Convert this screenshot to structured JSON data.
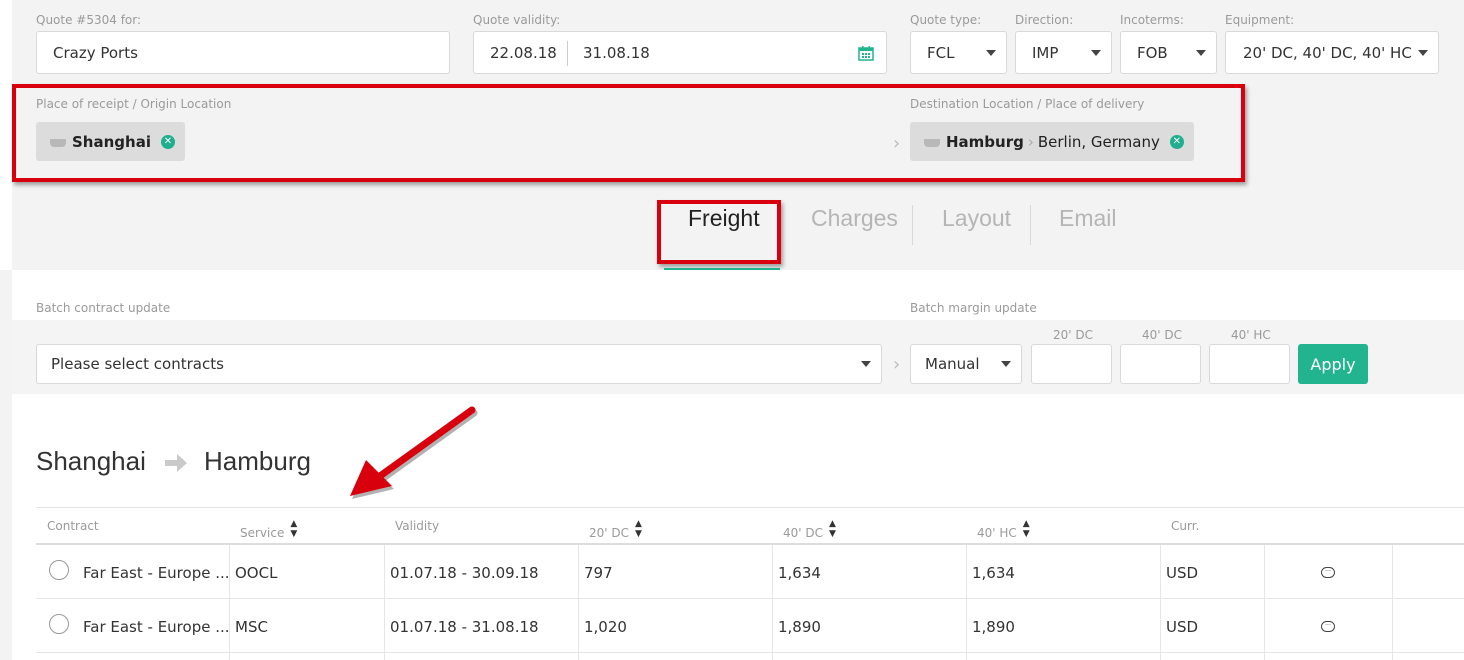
{
  "quote": {
    "title_label": "Quote #5304 for:",
    "customer": "Crazy Ports",
    "validity_label": "Quote validity:",
    "valid_from": "22.08.18",
    "valid_to": "31.08.18",
    "type_label": "Quote type:",
    "type_value": "FCL",
    "direction_label": "Direction:",
    "direction_value": "IMP",
    "incoterms_label": "Incoterms:",
    "incoterms_value": "FOB",
    "equipment_label": "Equipment:",
    "equipment_value": "20' DC, 40' DC, 40' HC"
  },
  "route": {
    "origin_label": "Place of receipt / Origin Location",
    "origin": "Shanghai",
    "destination_label": "Destination Location / Place of delivery",
    "destination_port": "Hamburg",
    "destination_place": "Berlin, Germany"
  },
  "tabs": [
    "Freight",
    "Charges",
    "Layout",
    "Email"
  ],
  "batch": {
    "contract_label": "Batch contract update",
    "contract_placeholder": "Please select contracts",
    "margin_label": "Batch margin update",
    "margin_mode": "Manual",
    "col1": "20' DC",
    "col2": "40' DC",
    "col3": "40' HC",
    "apply": "Apply"
  },
  "section": {
    "from": "Shanghai",
    "to": "Hamburg"
  },
  "table": {
    "headers": [
      "Contract",
      "Service",
      "Validity",
      "20' DC",
      "40' DC",
      "40' HC",
      "Curr."
    ],
    "rows": [
      {
        "contract": "Far East - Europe ...",
        "service": "OOCL",
        "validity": "01.07.18 - 30.09.18",
        "dc20": "797",
        "dc40": "1,634",
        "hc40": "1,634",
        "curr": "USD"
      },
      {
        "contract": "Far East - Europe ...",
        "service": "MSC",
        "validity": "01.07.18 - 31.08.18",
        "dc20": "1,020",
        "dc40": "1,890",
        "hc40": "1,890",
        "curr": "USD"
      }
    ]
  },
  "colors": {
    "accent": "#22b48e",
    "highlight": "#d8000c"
  }
}
